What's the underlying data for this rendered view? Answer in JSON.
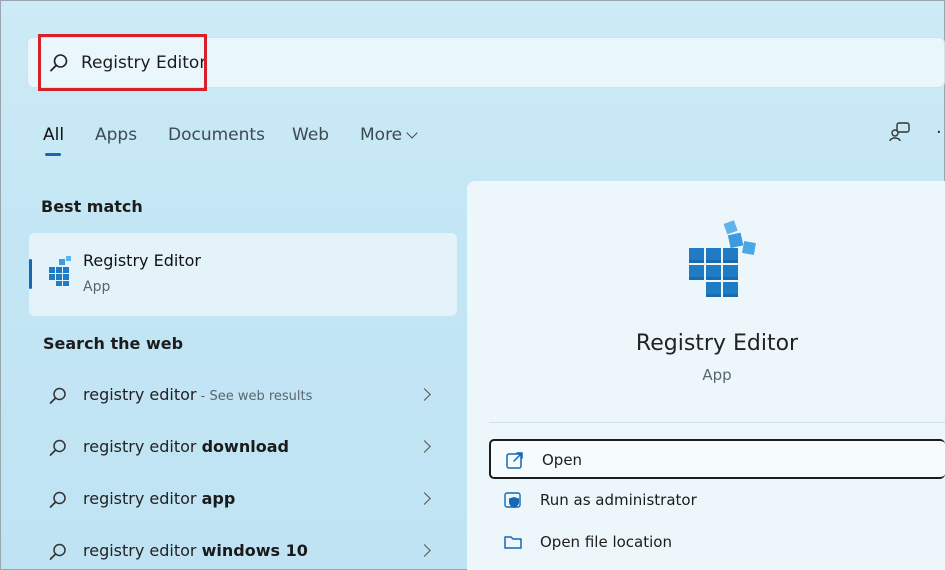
{
  "search": {
    "query": "Registry Editor"
  },
  "tabs": [
    {
      "label": "All",
      "active": true
    },
    {
      "label": "Apps"
    },
    {
      "label": "Documents"
    },
    {
      "label": "Web"
    },
    {
      "label": "More"
    }
  ],
  "best_match": {
    "section_title": "Best match",
    "title": "Registry Editor",
    "subtitle": "App"
  },
  "web": {
    "section_title": "Search the web",
    "results": [
      {
        "prefix": "registry editor",
        "bold": "",
        "suffix": " - See web results"
      },
      {
        "prefix": "registry editor ",
        "bold": "download",
        "suffix": ""
      },
      {
        "prefix": "registry editor ",
        "bold": "app",
        "suffix": ""
      },
      {
        "prefix": "registry editor ",
        "bold": "windows 10",
        "suffix": ""
      }
    ]
  },
  "detail": {
    "title": "Registry Editor",
    "subtitle": "App",
    "actions": [
      {
        "label": "Open"
      },
      {
        "label": "Run as administrator"
      },
      {
        "label": "Open file location"
      }
    ]
  },
  "colors": {
    "accent": "#1667b4",
    "highlight": "#d6202a"
  }
}
